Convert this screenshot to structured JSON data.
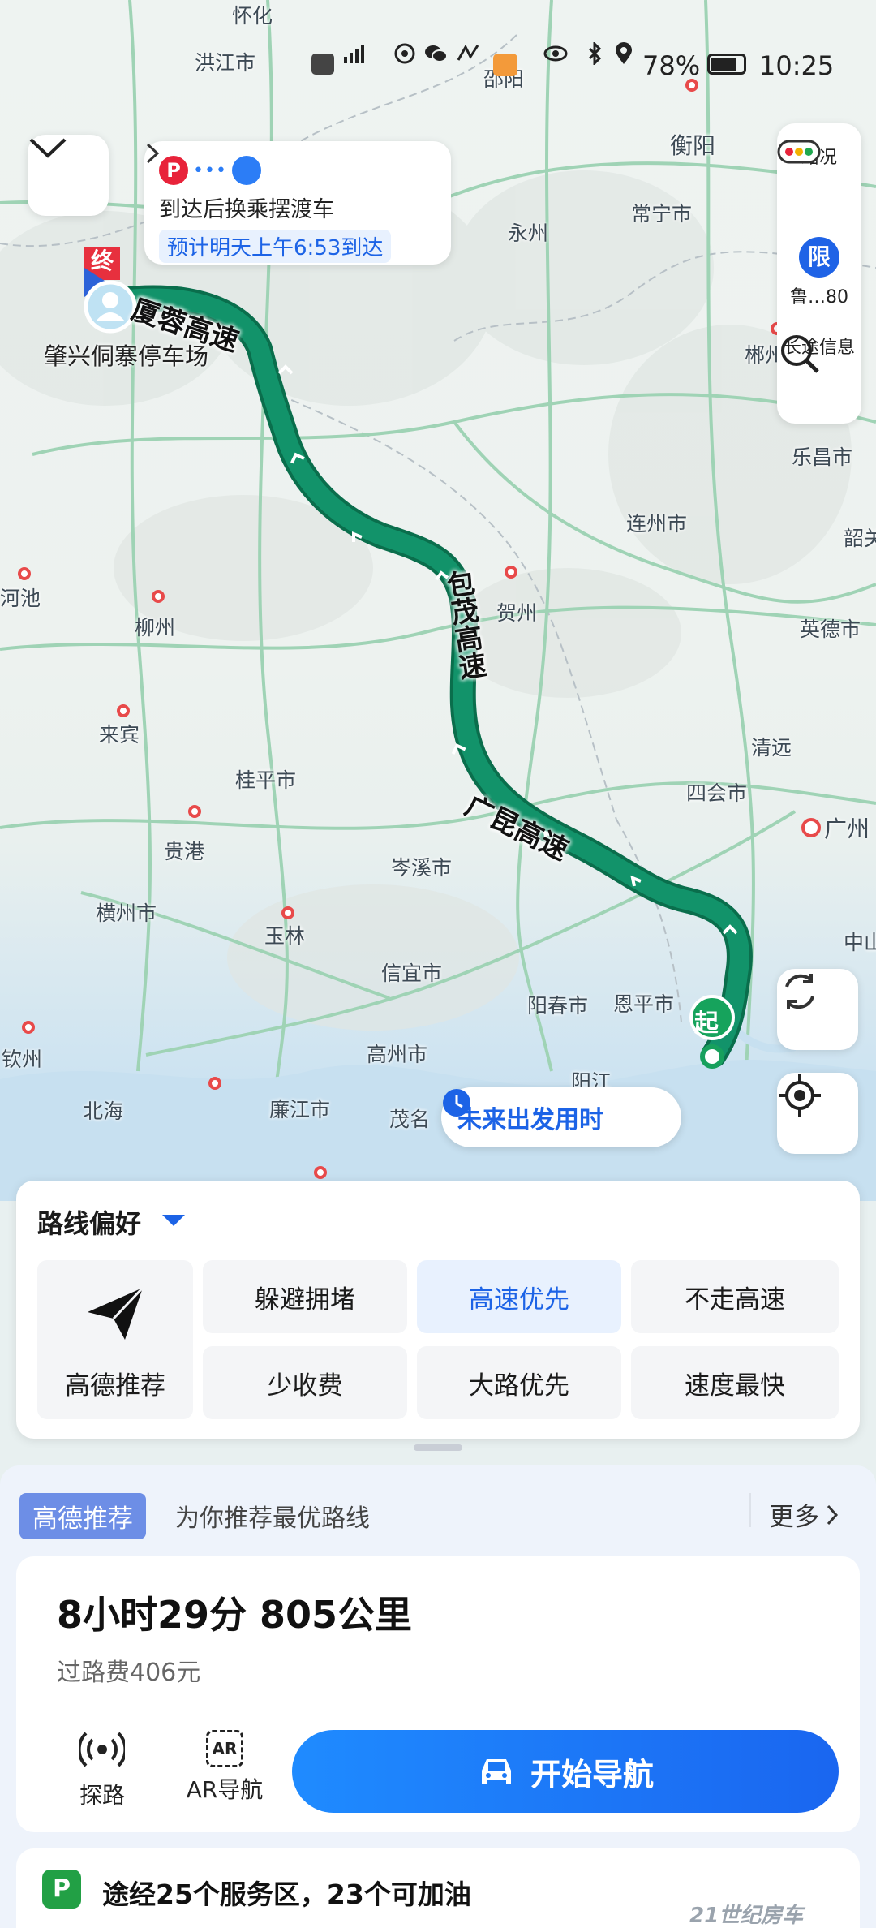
{
  "status_bar": {
    "left_icons": [
      "hd-icon",
      "5g-signal-icon",
      "circle-app-icon",
      "wechat-icon",
      "route-app-icon",
      "heart-app-icon"
    ],
    "right_icons": [
      "eye-icon",
      "bluetooth-icon",
      "location-icon"
    ],
    "battery": "78%",
    "time": "10:25"
  },
  "map": {
    "cities": [
      {
        "name": "怀化"
      },
      {
        "name": "洪江市"
      },
      {
        "name": "邵阳"
      },
      {
        "name": "衡阳"
      },
      {
        "name": "常宁市"
      },
      {
        "name": "永州"
      },
      {
        "name": "郴州"
      },
      {
        "name": "乐昌市"
      },
      {
        "name": "韶关"
      },
      {
        "name": "连州市"
      },
      {
        "name": "河池"
      },
      {
        "name": "柳州"
      },
      {
        "name": "贺州"
      },
      {
        "name": "英德市"
      },
      {
        "name": "来宾"
      },
      {
        "name": "清远"
      },
      {
        "name": "桂平市"
      },
      {
        "name": "四会市"
      },
      {
        "name": "广州"
      },
      {
        "name": "贵港"
      },
      {
        "name": "岑溪市"
      },
      {
        "name": "横州市"
      },
      {
        "name": "玉林"
      },
      {
        "name": "中山"
      },
      {
        "name": "信宜市"
      },
      {
        "name": "阳春市"
      },
      {
        "name": "恩平市"
      },
      {
        "name": "钦州"
      },
      {
        "name": "高州市"
      },
      {
        "name": "阳江"
      },
      {
        "name": "北海"
      },
      {
        "name": "廉江市"
      },
      {
        "name": "茂名"
      }
    ],
    "highways": [
      "厦蓉高速",
      "包茂高速",
      "广昆高速"
    ],
    "destination_marker": "终",
    "destination_name": "肇兴侗寨停车场",
    "start_marker": "起",
    "route_color": "#0f8a61"
  },
  "arrival_card": {
    "title": "到达后换乘摆渡车",
    "eta": "预计明天上午6:53到达",
    "p_label": "P"
  },
  "tools": {
    "traffic": "路况",
    "limit_badge": "限",
    "limit_label": "鲁…80",
    "long_trip": "长途信息"
  },
  "future_departure": "未来出发用时",
  "route_preference": {
    "title": "路线偏好",
    "main_option": "高德推荐",
    "options": [
      {
        "label": "躲避拥堵",
        "active": false
      },
      {
        "label": "高速优先",
        "active": true
      },
      {
        "label": "不走高速",
        "active": false
      },
      {
        "label": "少收费",
        "active": false
      },
      {
        "label": "大路优先",
        "active": false
      },
      {
        "label": "速度最快",
        "active": false
      }
    ]
  },
  "recommendation": {
    "badge": "高德推荐",
    "description": "为你推荐最优路线",
    "more": "更多"
  },
  "route": {
    "summary": "8小时29分  805公里",
    "toll": "过路费406元",
    "explore": "探路",
    "ar_nav": "AR导航",
    "ar_icon_text": "AR",
    "start_nav": "开始导航"
  },
  "service": {
    "icon_letter": "P",
    "text": "途经25个服务区，23个可加油"
  },
  "watermark": "21世纪房车",
  "colors": {
    "accent": "#1c63e6",
    "route": "#0f8a61",
    "service_green": "#22a045"
  }
}
